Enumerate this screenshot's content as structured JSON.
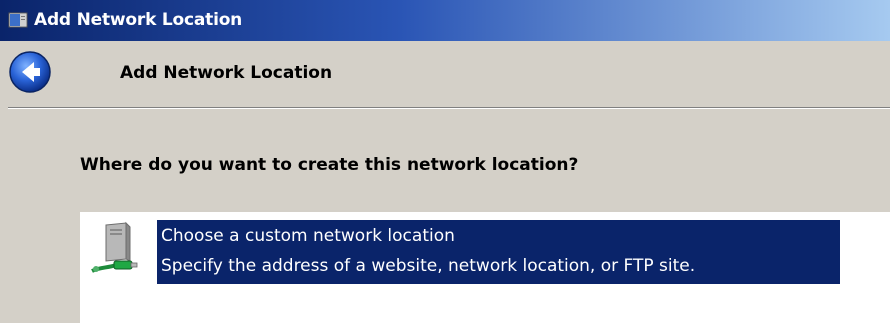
{
  "window": {
    "title": "Add Network Location"
  },
  "header": {
    "title": "Add Network Location",
    "back_icon": "back-arrow-icon"
  },
  "main": {
    "question": "Where do you want to create this network location?",
    "options": [
      {
        "title": "Choose a custom network location",
        "description": "Specify the address of a website, network location, or FTP site.",
        "icon": "network-location-icon",
        "selected": true
      }
    ]
  },
  "colors": {
    "titlebar_start": "#0a246a",
    "titlebar_end": "#a6caf0",
    "selection": "#0a246a",
    "window_bg": "#d4d0c8",
    "panel_bg": "#ffffff"
  }
}
